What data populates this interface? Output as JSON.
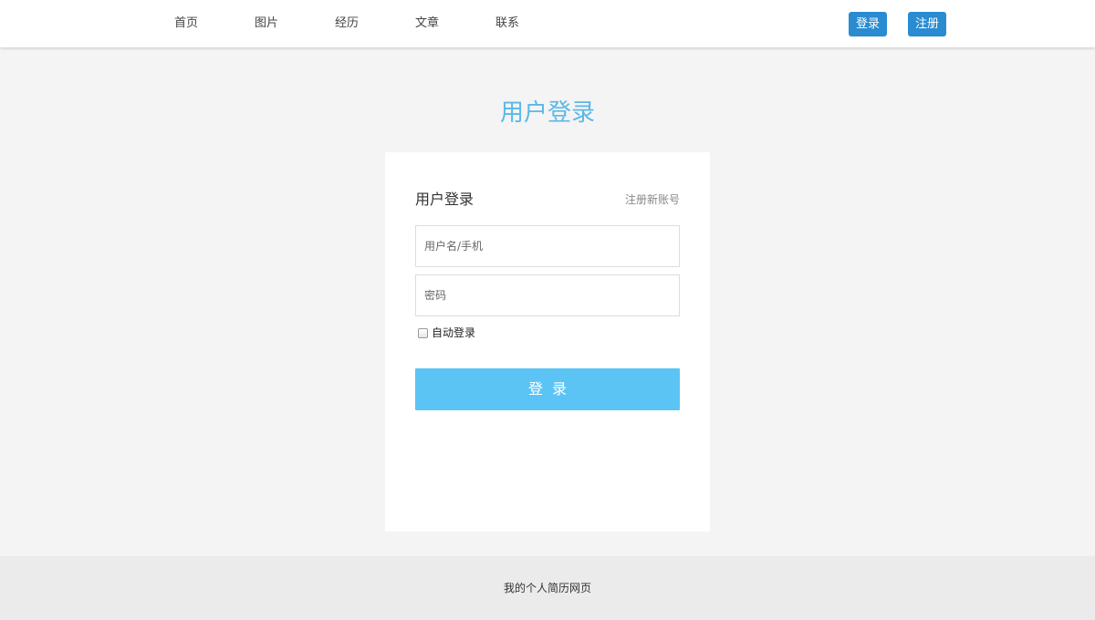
{
  "nav": {
    "items": [
      {
        "label": "首页"
      },
      {
        "label": "图片"
      },
      {
        "label": "经历"
      },
      {
        "label": "文章"
      },
      {
        "label": "联系"
      }
    ],
    "login_button": "登录",
    "register_button": "注册"
  },
  "page_title": "用户登录",
  "login_form": {
    "title": "用户登录",
    "register_link": "注册新账号",
    "username_placeholder": "用户名/手机",
    "password_placeholder": "密码",
    "remember_label": "自动登录",
    "remember_checked": false,
    "submit_label": "登录"
  },
  "footer": {
    "text": "我的个人简历网页"
  },
  "colors": {
    "nav_button": "#2a8bd1",
    "title_accent": "#5ab8e8",
    "submit_button": "#5bc4f5",
    "page_background": "#f4f4f4",
    "footer_background": "#ebebeb"
  }
}
